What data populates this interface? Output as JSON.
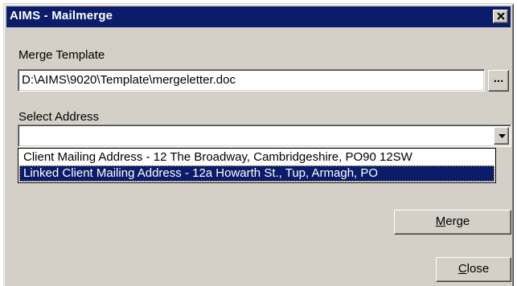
{
  "window": {
    "title": "AIMS - Mailmerge",
    "close_icon": "close-icon"
  },
  "template": {
    "label": "Merge Template",
    "path": "D:\\AIMS\\9020\\Template\\mergeletter.doc",
    "browse_label": "..."
  },
  "address": {
    "label": "Select Address",
    "selected_value": "",
    "dropdown_icon": "chevron-down-icon",
    "options": [
      "Client Mailing Address - 12 The Broadway, Cambridgeshire, PO90 12SW",
      "Linked Client Mailing Address - 12a Howarth St., Tup, Armagh, PO"
    ],
    "highlighted_index": 1
  },
  "buttons": {
    "merge": {
      "mnemonic": "M",
      "rest": "erge"
    },
    "close": {
      "mnemonic": "C",
      "rest": "lose"
    }
  },
  "colors": {
    "titlebar": "#0a1c6a",
    "dialog_face": "#d4d0c8",
    "selection": "#0a1c6a"
  }
}
